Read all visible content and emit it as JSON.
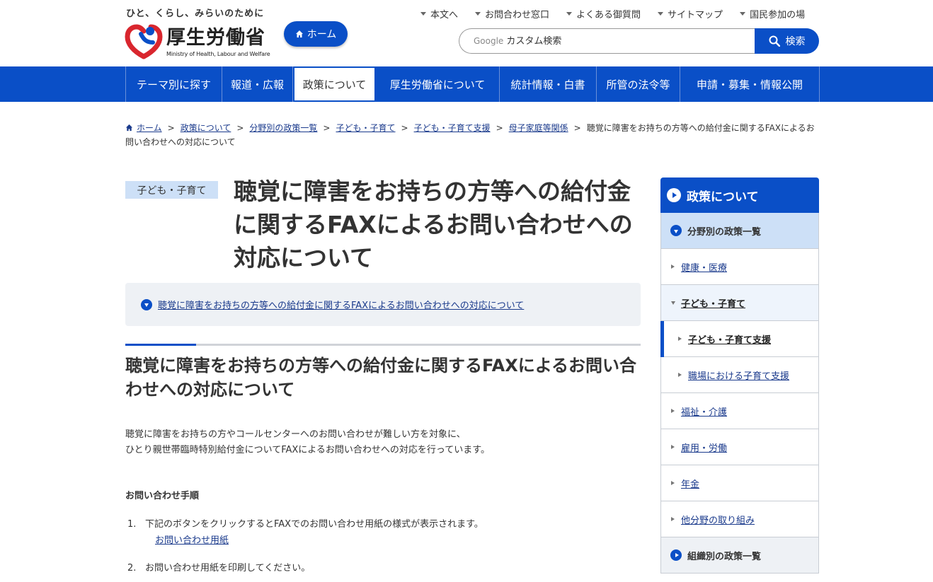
{
  "header": {
    "tagline": "ひと、くらし、みらいのために",
    "logo_name": "厚生労働省",
    "logo_en": "Ministry of Health, Labour and Welfare",
    "home_button": "ホーム",
    "util_links": [
      "本文へ",
      "お問合わせ窓口",
      "よくある御質問",
      "サイトマップ",
      "国民参加の場"
    ],
    "search": {
      "engine_label": "Google",
      "placeholder": "カスタム検索",
      "button": "検索"
    }
  },
  "gnav": {
    "items": [
      "テーマ別に探す",
      "報道・広報",
      "政策について",
      "厚生労働省について",
      "統計情報・白書",
      "所管の法令等",
      "申請・募集・情報公開"
    ],
    "active": "政策について"
  },
  "breadcrumb": {
    "items": [
      "ホーム",
      "政策について",
      "分野別の政策一覧",
      "子ども・子育て",
      "子ども・子育て支援",
      "母子家庭等関係"
    ],
    "current": "聴覚に障害をお持ちの方等への給付金に関するFAXによるお問い合わせへの対応について"
  },
  "main": {
    "category": "子ども・子育て",
    "title": "聴覚に障害をお持ちの方等への給付金に関するFAXによるお問い合わせへの対応について",
    "toc_link": "聴覚に障害をお持ちの方等への給付金に関するFAXによるお問い合わせへの対応について",
    "h2": "聴覚に障害をお持ちの方等への給付金に関するFAXによるお問い合わせへの対応について",
    "intro_line1": "聴覚に障害をお持ちの方やコールセンターへのお問い合わせが難しい方を対象に、",
    "intro_line2": "ひとり親世帯臨時特別給付金についてFAXによるお問い合わせへの対応を行っています。",
    "procedure_heading": "お問い合わせ手順",
    "steps": [
      {
        "num": "1.",
        "text": "下記のボタンをクリックするとFAXでのお問い合わせ用紙の様式が表示されます。",
        "link": "お問い合わせ用紙"
      },
      {
        "num": "2.",
        "text": "お問い合わせ用紙を印刷してください。"
      }
    ]
  },
  "sidebar": {
    "heading": "政策について",
    "section1": "分野別の政策一覧",
    "items": [
      "健康・医療",
      "子ども・子育て",
      "子ども・子育て支援",
      "職場における子育て支援",
      "福祉・介護",
      "雇用・労働",
      "年金",
      "他分野の取り組み"
    ],
    "section2": "組織別の政策一覧"
  },
  "colors": {
    "brand_blue": "#0a4fc7",
    "badge_bg": "#cde0f7",
    "panel_bg": "#eef1f5"
  }
}
